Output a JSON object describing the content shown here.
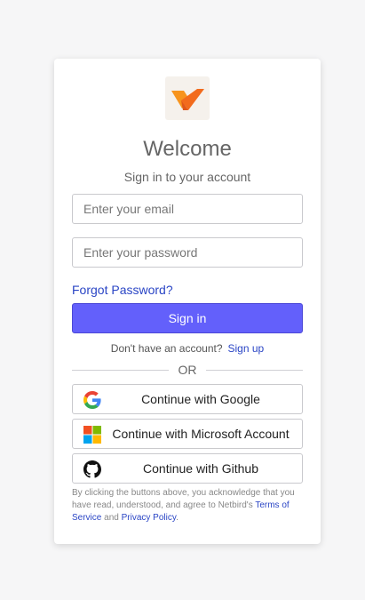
{
  "brand": {
    "logo_icon": "netbird-logo-icon",
    "accent": "#f26b1d",
    "primary": "#6360fb"
  },
  "header": {
    "title": "Welcome",
    "subtitle": "Sign in to your account"
  },
  "form": {
    "email_placeholder": "Enter your email",
    "password_placeholder": "Enter your password",
    "forgot_label": "Forgot Password?",
    "signin_label": "Sign in"
  },
  "signup": {
    "question": "Don't have an account?",
    "link": "Sign up"
  },
  "divider": {
    "label": "OR"
  },
  "social": [
    {
      "label": "Continue with Google",
      "icon": "google-icon"
    },
    {
      "label": "Continue with Microsoft Account",
      "icon": "microsoft-icon"
    },
    {
      "label": "Continue with Github",
      "icon": "github-icon"
    }
  ],
  "legal": {
    "text_before": "By clicking the buttons above, you acknowledge that you have read, understood, and agree to Netbird's ",
    "terms": "Terms of Service",
    "and": " and ",
    "privacy": "Privacy Policy",
    "end": "."
  }
}
